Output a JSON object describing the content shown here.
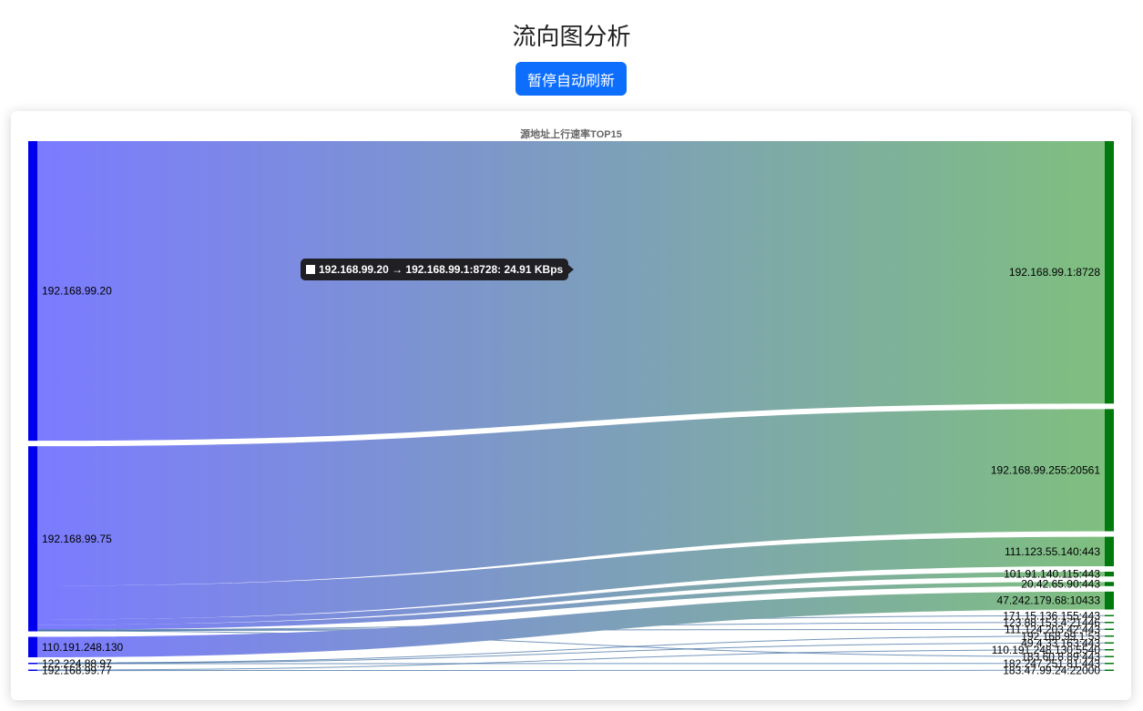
{
  "header": {
    "title": "流向图分析",
    "pause_label": "暂停自动刷新"
  },
  "tooltip": {
    "text": "192.168.99.20 → 192.168.99.1:8728: 24.91 KBps"
  },
  "colors": {
    "source_node": "#0000ee",
    "target_node": "#007a0c",
    "link_from": "#7b7bff",
    "link_to": "#7fbf7f",
    "button": "#0d6efd"
  },
  "chart_data": {
    "type": "sankey",
    "title": "源地址上行速率TOP15",
    "sources": [
      {
        "name": "192.168.99.20",
        "value": 24.91
      },
      {
        "name": "192.168.99.75",
        "value": 15.39
      },
      {
        "name": "110.191.248.130",
        "value": 1.7
      },
      {
        "name": "122.224.88.97",
        "value": 0.11
      },
      {
        "name": "192.168.99.77",
        "value": 0.06
      }
    ],
    "targets": [
      {
        "name": "192.168.99.1:8728",
        "value": 24.91
      },
      {
        "name": "192.168.99.255:20561",
        "value": 11.6
      },
      {
        "name": "111.123.55.140:443",
        "value": 2.8
      },
      {
        "name": "101.91.140.115:443",
        "value": 0.45
      },
      {
        "name": "20.42.65.90:443",
        "value": 0.4
      },
      {
        "name": "47.242.179.68:10433",
        "value": 1.7
      },
      {
        "name": "171.15.136.155:443",
        "value": 0.03
      },
      {
        "name": "123.88.153.4:21446",
        "value": 0.03
      },
      {
        "name": "111.124.203.42:443",
        "value": 0.03
      },
      {
        "name": "192.168.99.1:53",
        "value": 0.03
      },
      {
        "name": "49.4.33.163:443",
        "value": 0.03
      },
      {
        "name": "110.191.248.130:5540",
        "value": 0.03
      },
      {
        "name": "183.60.8.89:443",
        "value": 0.03
      },
      {
        "name": "182.247.251.81:443",
        "value": 0.03
      },
      {
        "name": "183.47.99.24:22000",
        "value": 0.03
      }
    ],
    "links": [
      {
        "source": "192.168.99.20",
        "target": "192.168.99.1:8728",
        "value": 24.91
      },
      {
        "source": "192.168.99.75",
        "target": "192.168.99.255:20561",
        "value": 11.6
      },
      {
        "source": "192.168.99.75",
        "target": "111.123.55.140:443",
        "value": 2.8
      },
      {
        "source": "192.168.99.75",
        "target": "101.91.140.115:443",
        "value": 0.45
      },
      {
        "source": "192.168.99.75",
        "target": "20.42.65.90:443",
        "value": 0.4
      },
      {
        "source": "192.168.99.75",
        "target": "171.15.136.155:443",
        "value": 0.03
      },
      {
        "source": "192.168.99.75",
        "target": "123.88.153.4:21446",
        "value": 0.03
      },
      {
        "source": "192.168.99.75",
        "target": "111.124.203.42:443",
        "value": 0.03
      },
      {
        "source": "192.168.99.75",
        "target": "183.60.8.89:443",
        "value": 0.03
      },
      {
        "source": "110.191.248.130",
        "target": "47.242.179.68:10433",
        "value": 1.7
      },
      {
        "source": "122.224.88.97",
        "target": "192.168.99.1:53",
        "value": 0.03
      },
      {
        "source": "122.224.88.97",
        "target": "49.4.33.163:443",
        "value": 0.03
      },
      {
        "source": "122.224.88.97",
        "target": "182.247.251.81:443",
        "value": 0.03
      },
      {
        "source": "192.168.99.77",
        "target": "110.191.248.130:5540",
        "value": 0.03
      },
      {
        "source": "192.168.99.77",
        "target": "183.47.99.24:22000",
        "value": 0.03
      }
    ]
  }
}
